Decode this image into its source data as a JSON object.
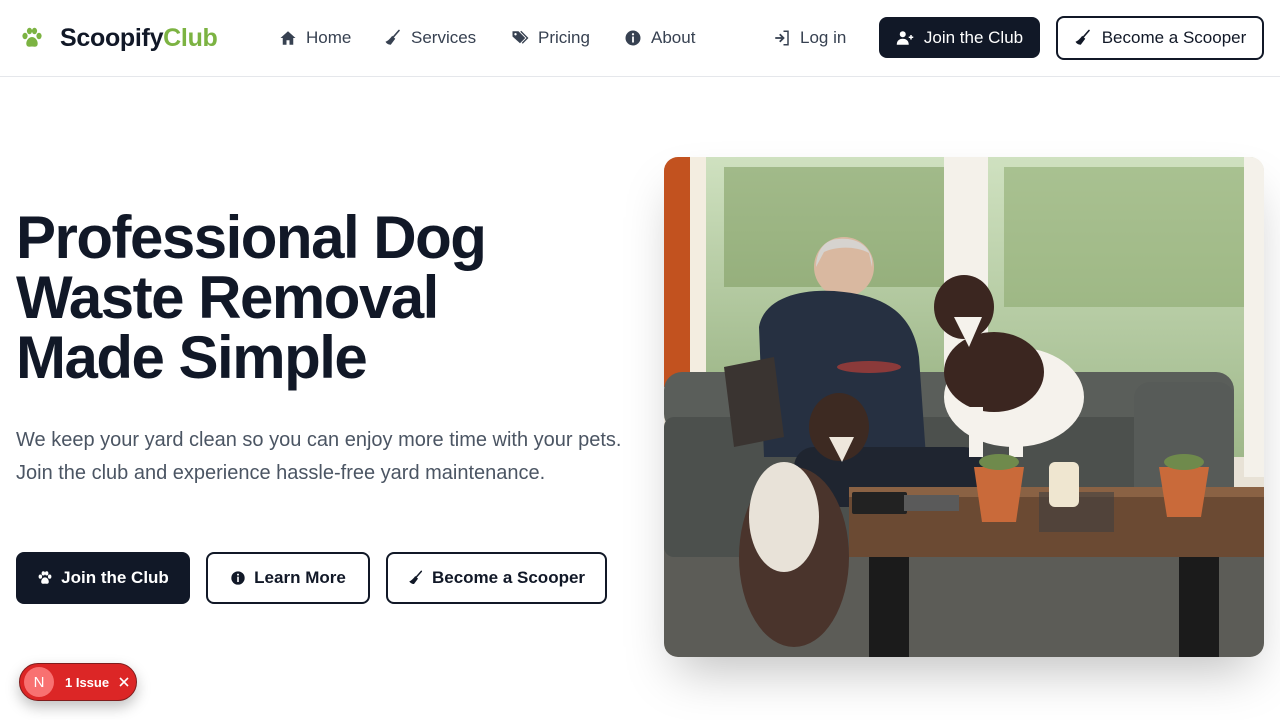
{
  "header": {
    "brand_main": "Scoopify",
    "brand_accent": "Club",
    "nav": [
      {
        "label": "Home",
        "icon": "home-icon"
      },
      {
        "label": "Services",
        "icon": "broom-icon"
      },
      {
        "label": "Pricing",
        "icon": "tags-icon"
      },
      {
        "label": "About",
        "icon": "info-icon"
      }
    ],
    "login_label": "Log in",
    "join_label": "Join the Club",
    "scooper_label": "Become a Scooper"
  },
  "hero": {
    "title_lines": [
      "Professional Dog",
      "Waste Removal",
      "Made Simple"
    ],
    "subtitle": "We keep your yard clean so you can enjoy more time with your pets. Join the club and experience hassle-free yard maintenance.",
    "buttons": {
      "join": "Join the Club",
      "learn": "Learn More",
      "scooper": "Become a Scooper"
    },
    "image_subject": "man-with-two-dogs-in-living-room"
  },
  "dev_overlay": {
    "initial": "N",
    "issues_label": "1 Issue"
  },
  "colors": {
    "accent": "#7cb342",
    "dark": "#111827",
    "issue_red": "#dc2626"
  }
}
